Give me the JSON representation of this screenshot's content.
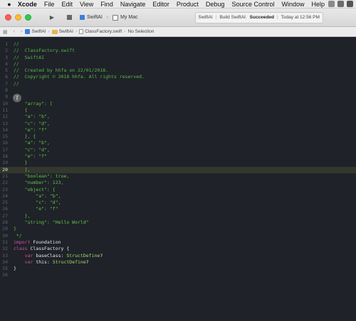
{
  "menubar": {
    "apple": "",
    "items": [
      "Xcode",
      "File",
      "Edit",
      "View",
      "Find",
      "Navigate",
      "Editor",
      "Product",
      "Debug",
      "Source Control",
      "Window",
      "Help"
    ]
  },
  "toolbar": {
    "scheme": "SwiftAI",
    "destination": "My Mac",
    "status_project": "SwiftAI",
    "status_build": "Build SwiftAI:",
    "status_result": "Succeeded",
    "status_time": "Today at 12:56 PM"
  },
  "jumpbar": {
    "crumbs": [
      "SwiftAI",
      "SwiftAI",
      "ClassFactory.swift",
      "No Selection"
    ]
  },
  "editor": {
    "current_line": 20,
    "lines": [
      [
        {
          "t": "//",
          "c": "comment"
        }
      ],
      [
        {
          "t": "//  ClassFactory.swift",
          "c": "comment"
        }
      ],
      [
        {
          "t": "//  SwiftAI",
          "c": "comment"
        }
      ],
      [
        {
          "t": "//",
          "c": "comment"
        }
      ],
      [
        {
          "t": "//  Created by hhfa on 22/01/2018.",
          "c": "comment"
        }
      ],
      [
        {
          "t": "//  Copyright © 2018 hhfa. All rights reserved.",
          "c": "comment"
        }
      ],
      [
        {
          "t": "//",
          "c": "comment"
        }
      ],
      [
        {
          "t": "",
          "c": "plain"
        }
      ],
      [
        {
          "t": "/*",
          "c": "comment"
        }
      ],
      [
        {
          "t": "    \"array\": [",
          "c": "string"
        }
      ],
      [
        {
          "t": "    {",
          "c": "string"
        }
      ],
      [
        {
          "t": "    \"a\": \"b\",",
          "c": "string"
        }
      ],
      [
        {
          "t": "    \"c\": \"d\",",
          "c": "string"
        }
      ],
      [
        {
          "t": "    \"e\": \"f\"",
          "c": "string"
        }
      ],
      [
        {
          "t": "    }, {",
          "c": "string"
        }
      ],
      [
        {
          "t": "    \"a\": \"b\",",
          "c": "string"
        }
      ],
      [
        {
          "t": "    \"c\": \"d\",",
          "c": "string"
        }
      ],
      [
        {
          "t": "    \"e\": \"f\"",
          "c": "string"
        }
      ],
      [
        {
          "t": "    }",
          "c": "string"
        }
      ],
      [
        {
          "t": "    ],",
          "c": "string"
        }
      ],
      [
        {
          "t": "    \"boolean\": true,",
          "c": "string"
        }
      ],
      [
        {
          "t": "    \"number\": 123,",
          "c": "string"
        }
      ],
      [
        {
          "t": "    \"object\": {",
          "c": "string"
        }
      ],
      [
        {
          "t": "        \"a\": \"b\",",
          "c": "string"
        }
      ],
      [
        {
          "t": "        \"c\": \"d\",",
          "c": "string"
        }
      ],
      [
        {
          "t": "        \"e\": \"f\"",
          "c": "string"
        }
      ],
      [
        {
          "t": "    },",
          "c": "string"
        }
      ],
      [
        {
          "t": "    \"string\": \"Hello World\"",
          "c": "string"
        }
      ],
      [
        {
          "t": "}",
          "c": "string"
        }
      ],
      [
        {
          "t": " */",
          "c": "comment"
        }
      ],
      [
        {
          "t": "import",
          "c": "keyword"
        },
        {
          "t": " Foundation",
          "c": "plain"
        }
      ],
      [
        {
          "t": "class",
          "c": "keyword"
        },
        {
          "t": " ClassFactory {",
          "c": "plain"
        }
      ],
      [
        {
          "t": "    ",
          "c": "plain"
        },
        {
          "t": "var",
          "c": "keyword"
        },
        {
          "t": " baseClass: ",
          "c": "plain"
        },
        {
          "t": "StructDefine",
          "c": "type"
        },
        {
          "t": "?",
          "c": "plain"
        }
      ],
      [
        {
          "t": "    ",
          "c": "plain"
        },
        {
          "t": "var",
          "c": "keyword"
        },
        {
          "t": " this: ",
          "c": "plain"
        },
        {
          "t": "StructDefine",
          "c": "type"
        },
        {
          "t": "?",
          "c": "plain"
        }
      ],
      [
        {
          "t": "}",
          "c": "plain"
        }
      ],
      [
        {
          "t": "",
          "c": "plain"
        }
      ]
    ]
  }
}
